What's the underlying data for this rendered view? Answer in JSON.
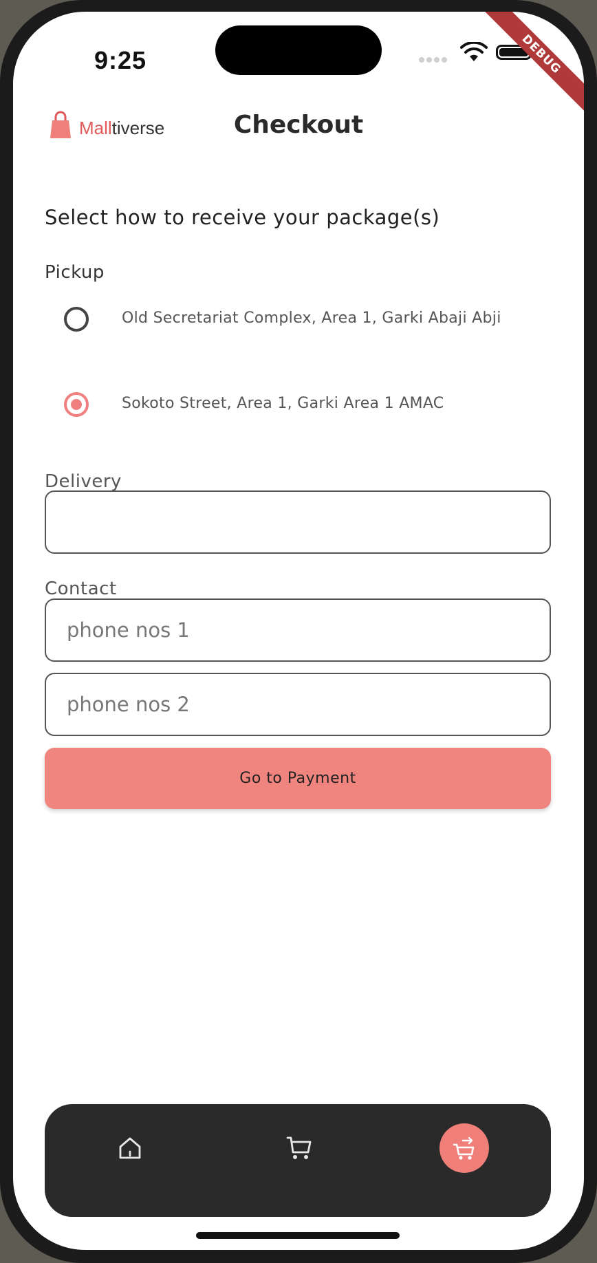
{
  "status_bar": {
    "time": "9:25",
    "debug_ribbon": "DEBUG"
  },
  "header": {
    "brand_highlight": "Mall",
    "brand_rest": "tiverse",
    "title": "Checkout"
  },
  "form": {
    "prompt": "Select how to receive your package(s)",
    "pickup": {
      "label": "Pickup",
      "options": [
        {
          "label": "Old Secretariat Complex, Area 1, Garki Abaji Abji",
          "selected": false
        },
        {
          "label": "Sokoto Street, Area 1, Garki Area 1 AMAC",
          "selected": true
        }
      ]
    },
    "delivery": {
      "label": "Delivery",
      "value": "",
      "placeholder": ""
    },
    "contact": {
      "label": "Contact",
      "phone1_placeholder": "phone nos 1",
      "phone2_placeholder": "phone nos 2"
    },
    "submit_label": "Go to Payment"
  },
  "bottom_nav": {
    "items": [
      {
        "icon": "home-icon",
        "active": false
      },
      {
        "icon": "cart-icon",
        "active": false
      },
      {
        "icon": "cart-checkout-icon",
        "active": true
      }
    ]
  },
  "colors": {
    "accent": "#f08580",
    "brand": "#e05a5a",
    "nav_bg": "#2a2a2a"
  }
}
